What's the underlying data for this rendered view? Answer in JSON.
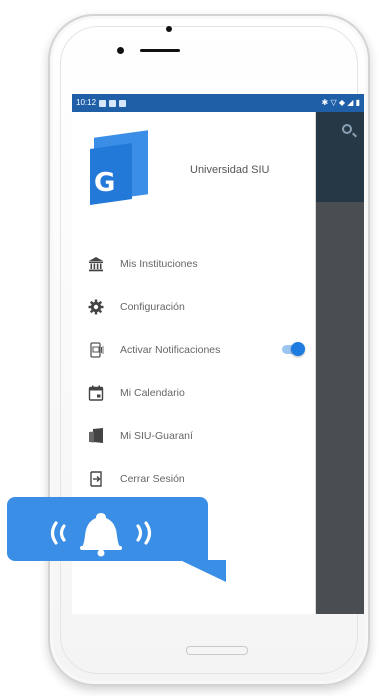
{
  "status_bar": {
    "time": "10:12",
    "right_indicators": "✱ ▽ ◆ ◢ ▮"
  },
  "drawer": {
    "logo_letter": "G",
    "org_name": "Universidad SIU",
    "items": [
      {
        "label": "Mis Instituciones",
        "icon": "institution-icon"
      },
      {
        "label": "Configuración",
        "icon": "gear-icon"
      },
      {
        "label": "Activar Notificaciones",
        "icon": "notification-device-icon",
        "toggle": true
      },
      {
        "label": "Mi Calendario",
        "icon": "calendar-icon"
      },
      {
        "label": "Mi SIU-Guaraní",
        "icon": "guarani-icon"
      },
      {
        "label": "Cerrar Sesión",
        "icon": "logout-icon"
      }
    ]
  },
  "notifications_toggle": {
    "on": true
  },
  "colors": {
    "accent": "#1e7be0",
    "bubble": "#3a8ee6",
    "status_bar": "#1f5fa8",
    "overlay": "#4c4c4c"
  }
}
